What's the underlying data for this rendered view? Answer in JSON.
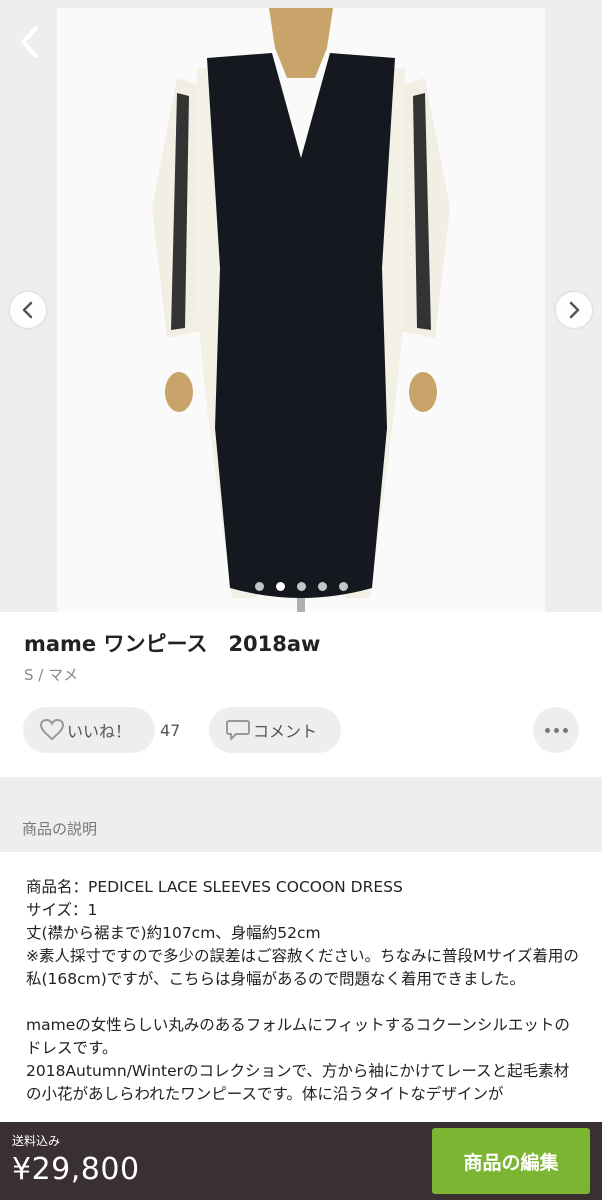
{
  "item": {
    "title": "mame ワンピース　2018aw",
    "subtitle": "S / マメ",
    "image_dots": {
      "count": 5,
      "active": 2
    }
  },
  "actions": {
    "like_label": "いいね！",
    "like_count": "47",
    "comment_label": "コメント"
  },
  "section": {
    "description_header": "商品の説明"
  },
  "description": "商品名：PEDICEL LACE SLEEVES COCOON DRESS\nサイズ：1\n丈(襟から裾まで)約107cm、身幅約52cm\n※素人採寸ですので多少の誤差はご容赦ください。ちなみに普段Mサイズ着用の私(168cm)ですが、こちらは身幅があるので問題なく着用できました。\n\nmameの女性らしい丸みのあるフォルムにフィットするコクーンシルエットのドレスです。\n2018Autumn/Winterのコレクションで、方から袖にかけてレースと起毛素材の小花があしらわれたワンピースです。体に沿うタイトなデザインが",
  "bottom": {
    "shipping_label": "送料込み",
    "price": "¥29,800",
    "edit_button": "商品の編集"
  },
  "colors": {
    "accent_green": "#7cb532",
    "bottom_bar": "#3b3031",
    "section_bg": "#eeeeee"
  },
  "icons": [
    "back-arrow-icon",
    "chevron-left-icon",
    "chevron-right-icon",
    "heart-icon",
    "comment-bubble-icon",
    "more-dots-icon"
  ]
}
